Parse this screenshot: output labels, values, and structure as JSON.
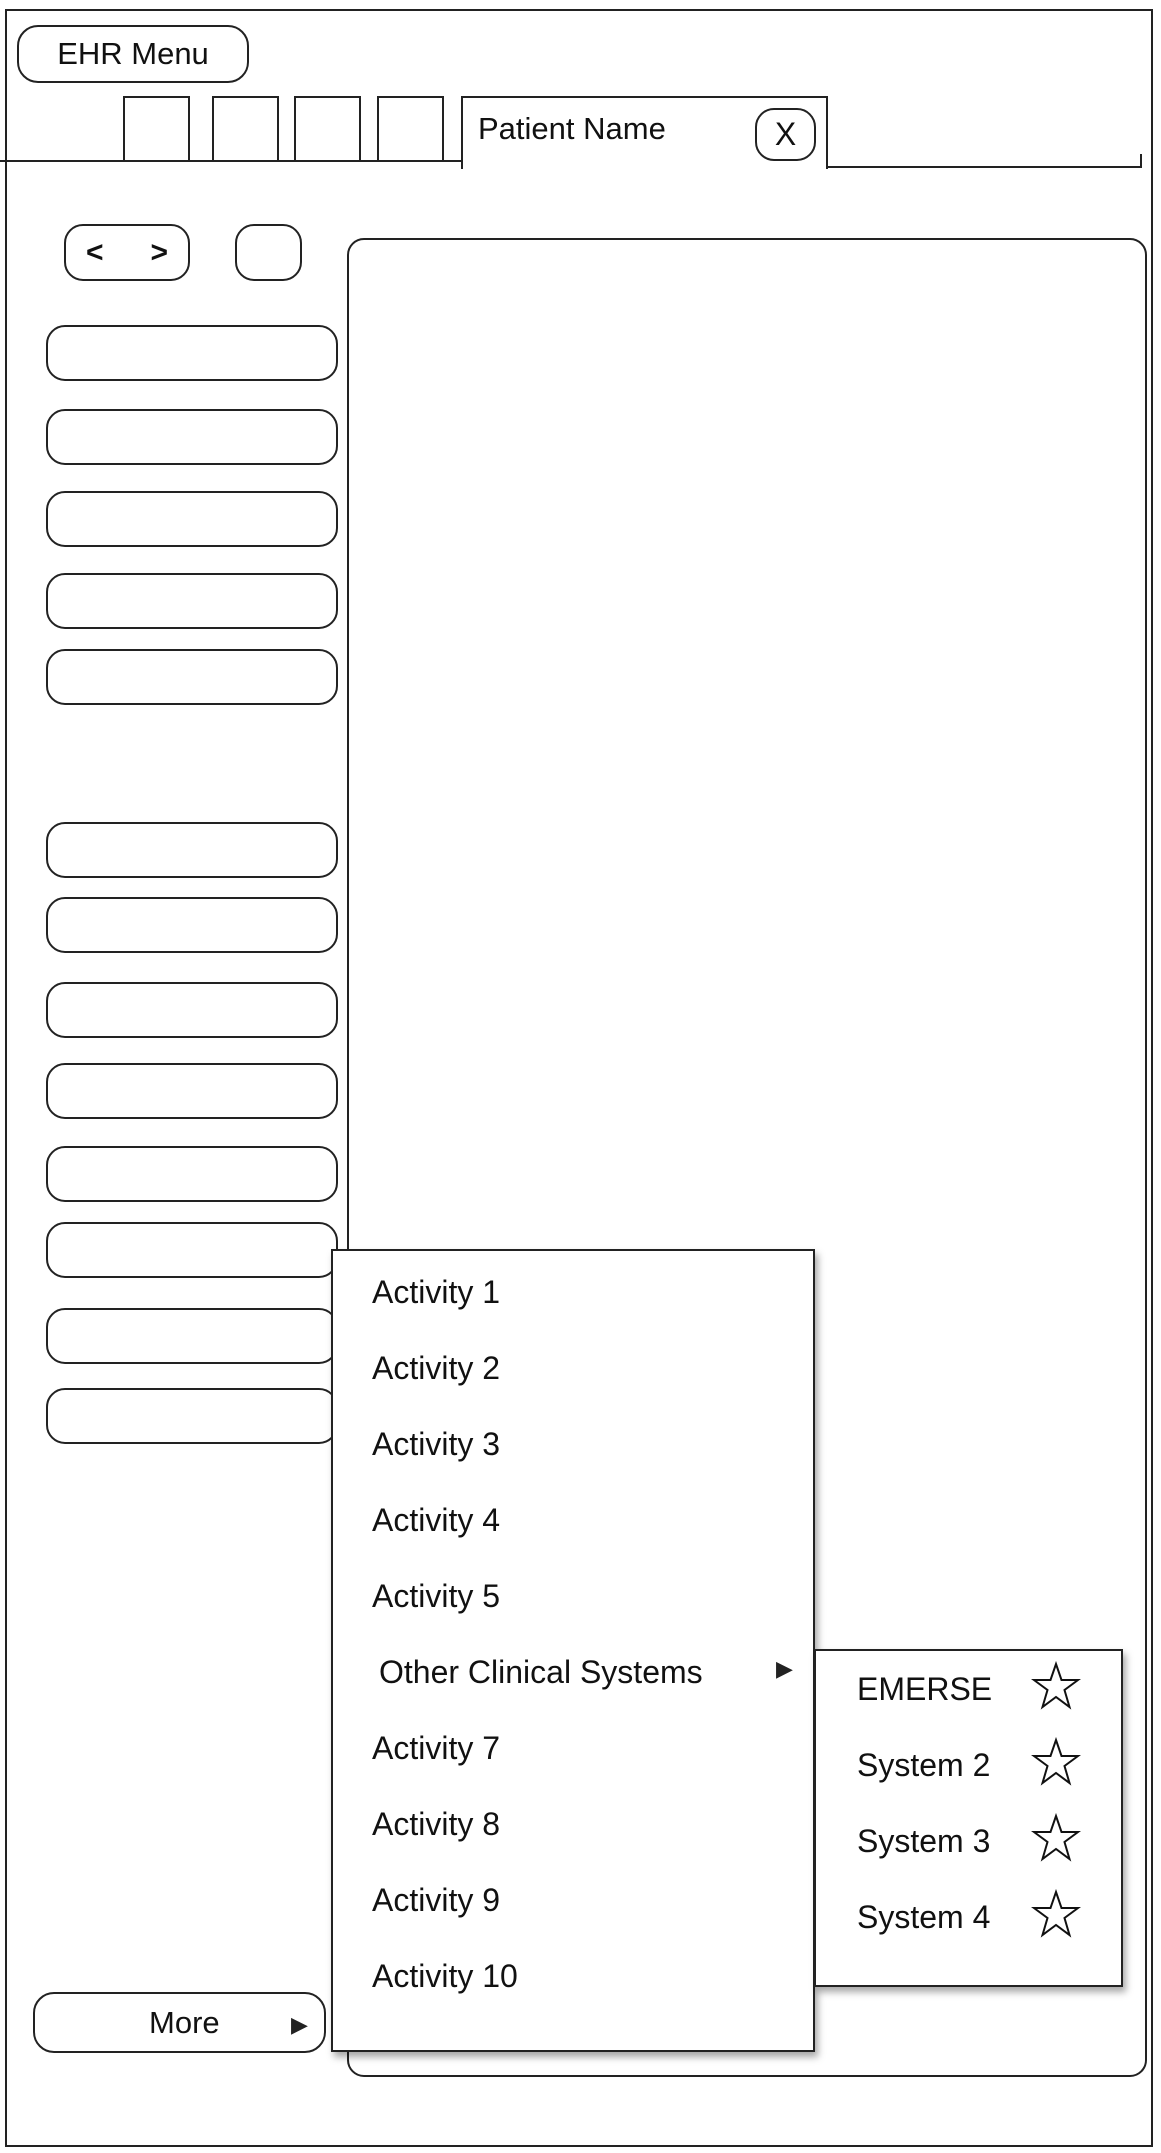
{
  "header": {
    "ehr_menu_label": "EHR Menu",
    "tabs": [
      {
        "label": ""
      },
      {
        "label": ""
      },
      {
        "label": ""
      },
      {
        "label": ""
      }
    ],
    "patient_tab": {
      "label": "Patient Name",
      "close_label": "X"
    }
  },
  "toolbar": {
    "back_label": "<",
    "forward_label": ">",
    "extra_button_label": ""
  },
  "sidebar": {
    "group1": [
      {
        "label": ""
      },
      {
        "label": ""
      },
      {
        "label": ""
      },
      {
        "label": ""
      },
      {
        "label": ""
      }
    ],
    "group2": [
      {
        "label": ""
      },
      {
        "label": ""
      },
      {
        "label": ""
      },
      {
        "label": ""
      },
      {
        "label": ""
      },
      {
        "label": ""
      },
      {
        "label": ""
      },
      {
        "label": ""
      }
    ],
    "more_label": "More",
    "more_arrow_icon": "triangle-right-icon"
  },
  "menu": {
    "items": [
      {
        "label": "Activity 1"
      },
      {
        "label": "Activity 2"
      },
      {
        "label": "Activity 3"
      },
      {
        "label": "Activity 4"
      },
      {
        "label": "Activity 5"
      },
      {
        "label": "Other Clinical Systems",
        "has_submenu": true
      },
      {
        "label": "Activity 7"
      },
      {
        "label": "Activity 8"
      },
      {
        "label": "Activity 9"
      },
      {
        "label": "Activity 10"
      }
    ]
  },
  "submenu": {
    "items": [
      {
        "label": "EMERSE",
        "icon": "star-outline-icon",
        "favorited": false
      },
      {
        "label": "System 2",
        "icon": "star-outline-icon",
        "favorited": false
      },
      {
        "label": "System 3",
        "icon": "star-outline-icon",
        "favorited": false
      },
      {
        "label": "System 4",
        "icon": "star-outline-icon",
        "favorited": false
      }
    ]
  },
  "colors": {
    "line": "#222222",
    "background": "#ffffff"
  }
}
